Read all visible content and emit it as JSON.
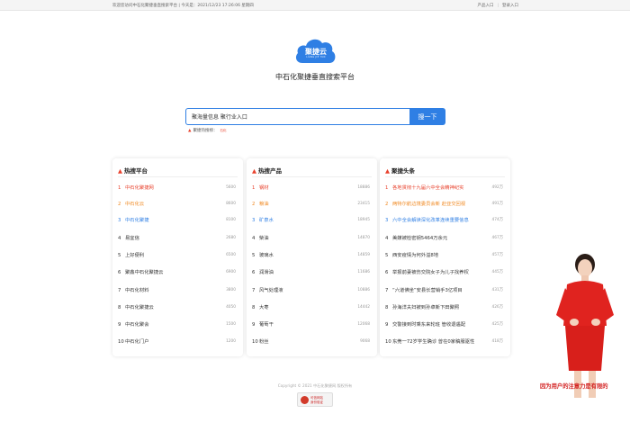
{
  "topbar": {
    "welcome": "欢迎您访问中石化聚捷垂直搜索平台 | 今天是：2021/12/23 17:26:06 星期四",
    "links": [
      "产品入口",
      "登录入口"
    ]
  },
  "logo": {
    "text": "聚捷云",
    "subtext": "LIANG JIE YUN"
  },
  "site_title": "中石化聚捷垂直搜索平台",
  "search": {
    "value": "聚海量信息 聚行业入口",
    "button": "搜一下"
  },
  "hot": {
    "label": "聚捷热搜榜：",
    "words": "石化"
  },
  "panels": [
    {
      "title": "热搜平台",
      "rows": [
        {
          "rank": "1",
          "name": "中石化聚捷网",
          "value": "5600"
        },
        {
          "rank": "2",
          "name": "中石化云",
          "value": "8600"
        },
        {
          "rank": "3",
          "name": "中石化聚捷",
          "value": "8100"
        },
        {
          "rank": "4",
          "name": "易宜信",
          "value": "2680"
        },
        {
          "rank": "5",
          "name": "上好便利",
          "value": "6500"
        },
        {
          "rank": "6",
          "name": "聚鑫中石化聚捷云",
          "value": "6900"
        },
        {
          "rank": "7",
          "name": "中石化材料",
          "value": "3800"
        },
        {
          "rank": "8",
          "name": "中石化聚捷云",
          "value": "4050"
        },
        {
          "rank": "9",
          "name": "中石化聚会",
          "value": "1500"
        },
        {
          "rank": "10",
          "name": "中石化门户",
          "value": "1200"
        }
      ]
    },
    {
      "title": "热搜产品",
      "rows": [
        {
          "rank": "1",
          "name": "钢材",
          "value": "18886"
        },
        {
          "rank": "2",
          "name": "粮油",
          "value": "23415"
        },
        {
          "rank": "3",
          "name": "矿泉水",
          "value": "18945"
        },
        {
          "rank": "4",
          "name": "柴油",
          "value": "14870"
        },
        {
          "rank": "5",
          "name": "玻璃水",
          "value": "14859"
        },
        {
          "rank": "6",
          "name": "润滑油",
          "value": "11686"
        },
        {
          "rank": "7",
          "name": "风气处理液",
          "value": "10886"
        },
        {
          "rank": "8",
          "name": "大枣",
          "value": "14442"
        },
        {
          "rank": "9",
          "name": "葡萄干",
          "value": "12068"
        },
        {
          "rank": "10",
          "name": "粉丝",
          "value": "9068"
        }
      ]
    },
    {
      "title": "聚捷头条",
      "rows": [
        {
          "rank": "1",
          "name": "各地贯彻十九届六中全会精神纪实",
          "value": "492万"
        },
        {
          "rank": "2",
          "name": "两特尔航边境委员会新 赴亚交回视",
          "value": "491万"
        },
        {
          "rank": "3",
          "name": "六中全会解读深化改革连续重要信息",
          "value": "474万"
        },
        {
          "rank": "4",
          "name": "美媒被检密钥5464万余元",
          "value": "467万"
        },
        {
          "rank": "5",
          "name": "西安疫情为何外溢8地",
          "value": "457万"
        },
        {
          "rank": "6",
          "name": "举报前妻被伤交院女子为儿子找养权",
          "value": "445万"
        },
        {
          "rank": "7",
          "name": "“六道佛坐”安县长营销手3亿项目",
          "value": "431万"
        },
        {
          "rank": "8",
          "name": "孙海洋夫妇被到孙卓新下田聚照",
          "value": "426万"
        },
        {
          "rank": "9",
          "name": "交警接到时乘东来轮班 管收退遇配",
          "value": "425万"
        },
        {
          "rank": "10",
          "name": "东莞一72岁学生确诊 曾在0家稿服驱性",
          "value": "418万"
        }
      ]
    }
  ],
  "footer": {
    "copyright": "Copyright © 2021 中石化聚捷网 版权所有"
  },
  "badge": {
    "text1": "可信网站",
    "text2": "身份验证"
  },
  "caption": "因为用户的注意力是有限的",
  "colors": {
    "accent": "#2f7fe4",
    "hot_red": "#e8412c",
    "orange": "#f08a24"
  }
}
